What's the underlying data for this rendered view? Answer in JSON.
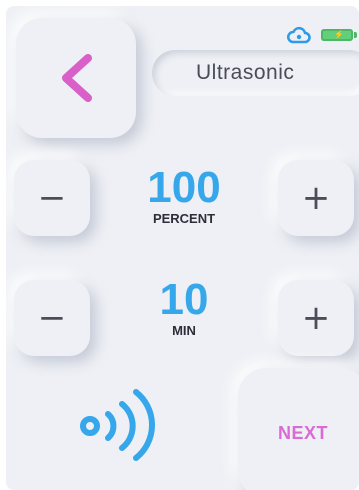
{
  "status": {
    "cloud_icon": "cloud-link-icon",
    "battery_icon": "battery-charging-icon",
    "cloud_color": "#2f9be6",
    "battery_color": "#62d07a"
  },
  "header": {
    "back_icon": "chevron-left-icon",
    "back_color": "#d95fc9",
    "mode_label": "Ultrasonic"
  },
  "intensity": {
    "decrement_label": "−",
    "increment_label": "+",
    "value": "100",
    "unit": "PERCENT"
  },
  "duration": {
    "decrement_label": "−",
    "increment_label": "+",
    "value": "10",
    "unit": "MIN"
  },
  "footer": {
    "signal_icon": "ultrasonic-wave-icon",
    "signal_color": "#35a7ea",
    "next_label": "NEXT",
    "next_color": "#d96bd6"
  }
}
